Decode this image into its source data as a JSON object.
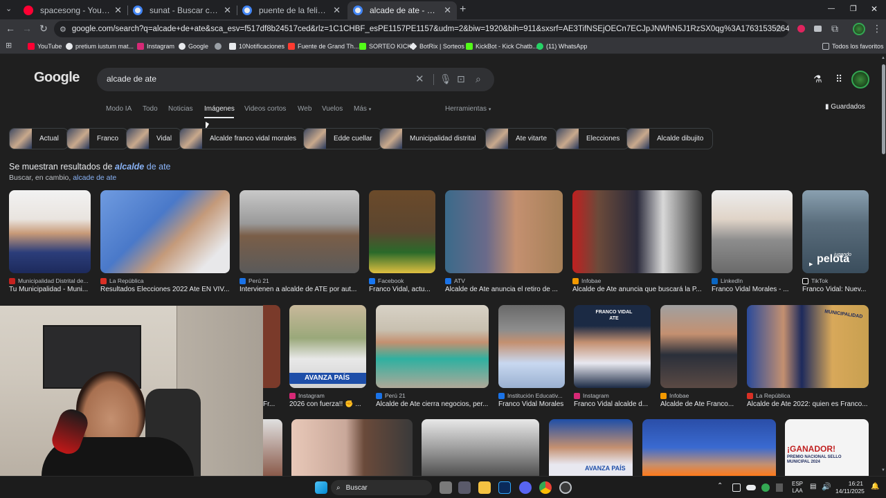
{
  "tabs": [
    {
      "title": "spacesong - YouTube",
      "favicon_color": "#ff0033"
    },
    {
      "title": "sunat - Buscar con Google",
      "favicon_color": "#e8eaed"
    },
    {
      "title": "puente de la felicidad barranco",
      "favicon_color": "#e8eaed"
    },
    {
      "title": "alcade de ate - Buscar con Goo",
      "favicon_color": "#e8eaed",
      "active": true
    }
  ],
  "new_tab": "+",
  "window_controls": {
    "minimize": "—",
    "maximize": "❐",
    "close": "✕"
  },
  "toolbar": {
    "url": "google.com/search?q=alcade+de+ate&sca_esv=f517df8b24517ced&rlz=1C1CHBF_esPE1157PE1157&udm=2&biw=1920&bih=911&sxsrf=AE3TifNSEjOECn7ECJpJNWhN5J1RzSX0qg%3A1763153526412&ei=dpYXadb3GK2d5OUPr8W0mQo&v..."
  },
  "bookmarks": [
    {
      "label": "YouTube",
      "color": "#ff0033"
    },
    {
      "label": "pretium iustum mat...",
      "color": "#e8eaed"
    },
    {
      "label": "Instagram",
      "color": "#d62976"
    },
    {
      "label": "Google",
      "color": "#e8eaed"
    },
    {
      "label": "",
      "color": "#9aa0a6"
    },
    {
      "label": "10Notificaciones",
      "color": "#e8eaed"
    },
    {
      "label": "Fuente de Grand Th...",
      "color": "#ff3b30"
    },
    {
      "label": "SORTEO KICK",
      "color": "#53fc18"
    },
    {
      "label": "BotRix | Sorteos",
      "color": "#e8eaed"
    },
    {
      "label": "KickBot - Kick Chatb...",
      "color": "#53fc18"
    },
    {
      "label": "(11) WhatsApp",
      "color": "#25d366"
    }
  ],
  "all_bookmarks": "Todos los favoritos",
  "search": {
    "logo": "Google",
    "query": "alcade de ate"
  },
  "nav": {
    "tabs": [
      "Modo IA",
      "Todo",
      "Noticias",
      "Imágenes",
      "Videos cortos",
      "Web",
      "Vuelos",
      "Más"
    ],
    "active": "Imágenes",
    "tools": "Herramientas",
    "saved": "Guardados"
  },
  "chips": [
    "Actual",
    "Franco",
    "Vidal",
    "Alcalde franco vidal morales",
    "Edde cuellar",
    "Municipalidad distrital",
    "Ate vitarte",
    "Elecciones",
    "Alcalde dibujito"
  ],
  "notice": {
    "prefix": "Se muestran resultados de ",
    "corrected_a": "alcalde",
    "corrected_b": " de ate",
    "alt_prefix": "Buscar, en cambio, ",
    "alt_query": "alcade de ate"
  },
  "row1": [
    {
      "source": "Municipalidad Distrital de...",
      "caption": "Tu Municipalidad - Muni...",
      "src_color": "#c5221f",
      "img": "#2b3d7a"
    },
    {
      "source": "La República",
      "caption": "Resultados Elecciones 2022 Ate EN VIV...",
      "src_color": "#d93025",
      "img": "#4a79c9"
    },
    {
      "source": "Perú 21",
      "caption": "Intervienen a alcalde de ATE por aut...",
      "src_color": "#1a73e8",
      "img": "#8a8a8a"
    },
    {
      "source": "Facebook",
      "caption": "Franco Vidal, actu...",
      "src_color": "#1877f2",
      "img": "#5b4630"
    },
    {
      "source": "ATV",
      "caption": "Alcalde de Ate anuncia el retiro de ...",
      "src_color": "#1a73e8",
      "img": "#a68058"
    },
    {
      "source": "Infobae",
      "caption": "Alcalde de Ate anuncia que buscará la P...",
      "src_color": "#f29900",
      "img": "#6b4a3a"
    },
    {
      "source": "LinkedIn",
      "caption": "Franco Vidal Morales - ...",
      "src_color": "#0a66c2",
      "img": "#c9c9c9"
    },
    {
      "source": "TikTok",
      "caption": "Franco Vidal: Nuev...",
      "src_color": "#111111",
      "img": "#3a4d5c",
      "overlay": "pelota",
      "overlay_small": "jugando"
    }
  ],
  "row2": [
    {
      "source": "",
      "caption": "Fr...",
      "src_color": "#888888",
      "img": "#7a3a2a"
    },
    {
      "source": "Instagram",
      "caption": "2026 con fuerza!! ✊ ...",
      "src_color": "#d62976",
      "img": "#9aa87a",
      "badge": "AVANZA PAÍS"
    },
    {
      "source": "Perú 21",
      "caption": "Alcalde de Ate cierra negocios, per...",
      "src_color": "#1a73e8",
      "img": "#c8c0b0"
    },
    {
      "source": "Institución Educativ...",
      "caption": "Franco Vidal Morales",
      "src_color": "#1a73e8",
      "img": "#8d8d8d"
    },
    {
      "source": "Instagram",
      "caption": "Franco Vidal alcalde d...",
      "src_color": "#d62976",
      "img": "#1b2a44",
      "banner": "FRANCO VIDAL ATE"
    },
    {
      "source": "Infobae",
      "caption": "Alcalde de Ate Franco...",
      "src_color": "#f29900",
      "img": "#5a4a44"
    },
    {
      "source": "La República",
      "caption": "Alcalde de Ate 2022: quien es Franco...",
      "src_color": "#d93025",
      "img": "#d8a85a",
      "banner": "MUNICIPALIDAD"
    }
  ],
  "row3": [
    {
      "img": "#8a5a4a"
    },
    {
      "img": "#c9a89a"
    },
    {
      "img": "#d0d0d0"
    },
    {
      "img": "#1e4ea8",
      "badge": "AVANZA PAÍS"
    },
    {
      "img": "#2a4ea8"
    },
    {
      "img": "#e8eaed",
      "badge": "¡GANADOR!",
      "sub": "PREMIO NACIONAL SELLO MUNICIPAL 2024"
    }
  ],
  "taskbar": {
    "search": "Buscar",
    "lang": "ESP",
    "lang2": "LAA",
    "time": "16:21",
    "date": "14/11/2025"
  }
}
